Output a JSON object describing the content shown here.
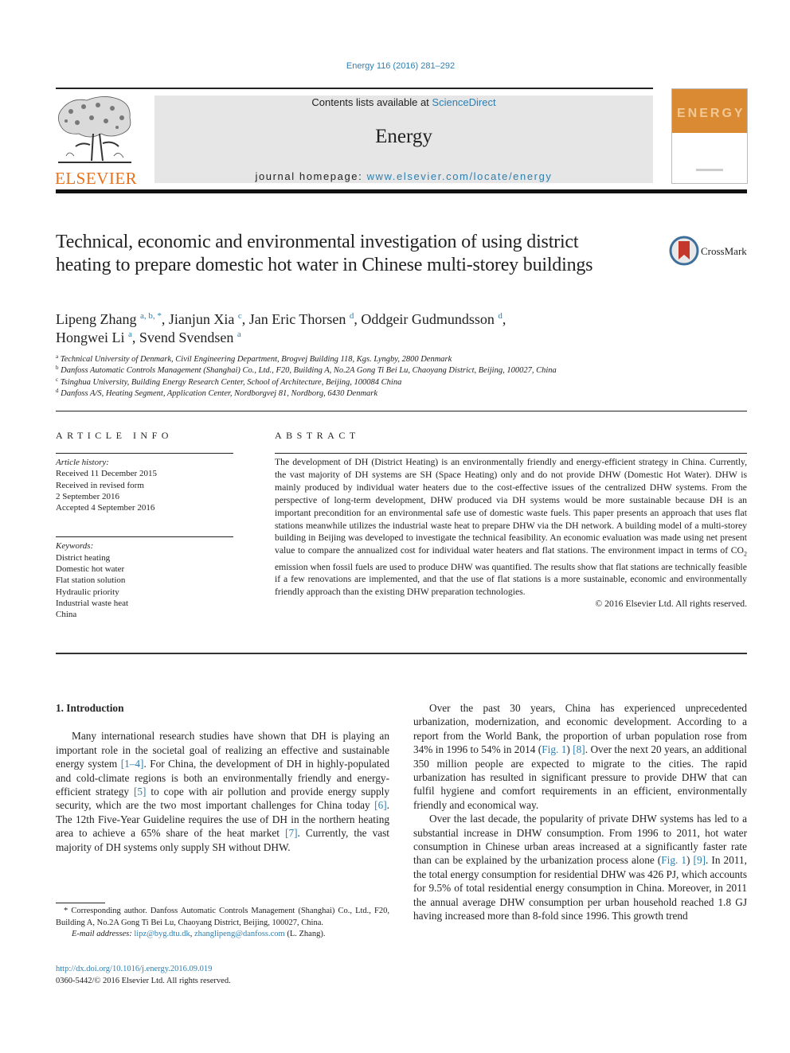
{
  "header": {
    "journal_ref": "Energy 116 (2016) 281–292",
    "contents_prefix": "Contents lists available at ",
    "contents_link": "ScienceDirect",
    "journal_name": "Energy",
    "homepage_prefix": "journal homepage: ",
    "homepage_link": "www.elsevier.com/locate/energy",
    "publisher_logo_text": "ELSEVIER",
    "cover_title": "ENERGY",
    "colors": {
      "link": "#2e7fb0",
      "publisher_orange": "#e9711c",
      "cover_orange": "#d98a33",
      "banner_gray": "#e6e6e6"
    }
  },
  "article": {
    "title": "Technical, economic and environmental investigation of using district heating to prepare domestic hot water in Chinese multi-storey buildings",
    "crossmark_label": "CrossMark",
    "authors": [
      {
        "name": "Lipeng Zhang",
        "sup": "a, b, *",
        "sep": ", "
      },
      {
        "name": "Jianjun Xia",
        "sup": "c",
        "sep": ", "
      },
      {
        "name": "Jan Eric Thorsen",
        "sup": "d",
        "sep": ", "
      },
      {
        "name": "Oddgeir Gudmundsson",
        "sup": "d",
        "sep": ","
      },
      {
        "name": "Hongwei Li",
        "sup": "a",
        "sep": ", "
      },
      {
        "name": "Svend Svendsen",
        "sup": "a",
        "sep": ""
      }
    ],
    "affiliations": [
      {
        "key": "a",
        "text": "Technical University of Denmark, Civil Engineering Department, Brogvej Building 118, Kgs. Lyngby, 2800 Denmark"
      },
      {
        "key": "b",
        "text": "Danfoss Automatic Controls Management (Shanghai) Co., Ltd., F20, Building A, No.2A Gong Ti Bei Lu, Chaoyang District, Beijing, 100027, China"
      },
      {
        "key": "c",
        "text": "Tsinghua University, Building Energy Research Center, School of Architecture, Beijing, 100084 China"
      },
      {
        "key": "d",
        "text": "Danfoss A/S, Heating Segment, Application Center, Nordborgvej 81, Nordborg, 6430 Denmark"
      }
    ]
  },
  "article_info": {
    "heading": "ARTICLE INFO",
    "history_label": "Article history:",
    "history": [
      "Received 11 December 2015",
      "Received in revised form",
      "2 September 2016",
      "Accepted 4 September 2016"
    ],
    "keywords_label": "Keywords:",
    "keywords": [
      "District heating",
      "Domestic hot water",
      "Flat station solution",
      "Hydraulic priority",
      "Industrial waste heat",
      "China"
    ]
  },
  "abstract": {
    "heading": "ABSTRACT",
    "text_before_co2": "The development of DH (District Heating) is an environmentally friendly and energy-efficient strategy in China. Currently, the vast majority of DH systems are SH (Space Heating) only and do not provide DHW (Domestic Hot Water). DHW is mainly produced by individual water heaters due to the cost-effective issues of the centralized DHW systems. From the perspective of long-term development, DHW produced via DH systems would be more sustainable because DH is an important precondition for an environmental safe use of domestic waste fuels. This paper presents an approach that uses flat stations meanwhile utilizes the industrial waste heat to prepare DHW via the DH network. A building model of a multi-storey building in Beijing was developed to investigate the technical feasibility. An economic evaluation was made using net present value to compare the annualized cost for individual water heaters and flat stations. The environment impact in terms of CO",
    "co2_sub": "2",
    "text_after_co2": " emission when fossil fuels are used to produce DHW was quantified. The results show that flat stations are technically feasible if a few renovations are implemented, and that the use of flat stations is a more sustainable, economic and environmentally friendly approach than the existing DHW preparation technologies.",
    "copyright": "© 2016 Elsevier Ltd. All rights reserved."
  },
  "body": {
    "section_heading": "1.  Introduction",
    "left_para": [
      {
        "t": "Many international research studies have shown that DH is playing an important role in the societal goal of realizing an effective and sustainable energy system "
      },
      {
        "ref": "[1–4]"
      },
      {
        "t": ". For China, the development of DH in highly-populated and cold-climate regions is both an environmentally friendly and energy-efficient strategy "
      },
      {
        "ref": "[5]"
      },
      {
        "t": " to cope with air pollution and provide energy supply security, which are the two most important challenges for China today "
      },
      {
        "ref": "[6]"
      },
      {
        "t": ". The 12th Five-Year Guideline requires the use of DH in the northern heating area to achieve a 65% share of the heat market "
      },
      {
        "ref": "[7]"
      },
      {
        "t": ". Currently, the vast majority of DH systems only supply SH without DHW."
      }
    ],
    "right_para_1": [
      {
        "t": "Over the past 30 years, China has experienced unprecedented urbanization, modernization, and economic development. According to a report from the World Bank, the proportion of urban population rose from 34% in 1996 to 54% in 2014 ("
      },
      {
        "ref": "Fig. 1"
      },
      {
        "t": ") "
      },
      {
        "ref": "[8]"
      },
      {
        "t": ". Over the next 20 years, an additional 350 million people are expected to migrate to the cities. The rapid urbanization has resulted in significant pressure to provide DHW that can fulfil hygiene and comfort requirements in an efficient, environmentally friendly and economical way."
      }
    ],
    "right_para_2": [
      {
        "t": "Over the last decade, the popularity of private DHW systems has led to a substantial increase in DHW consumption. From 1996 to 2011, hot water consumption in Chinese urban areas increased at a significantly faster rate than can be explained by the urbanization process alone ("
      },
      {
        "ref": "Fig. 1"
      },
      {
        "t": ") "
      },
      {
        "ref": "[9]"
      },
      {
        "t": ". In 2011, the total energy consumption for residential DHW was 426 PJ, which accounts for 9.5% of total residential energy consumption in China. Moreover, in 2011 the annual average DHW consumption per urban household reached 1.8 GJ having increased more than 8-fold since 1996. This growth trend"
      }
    ]
  },
  "footnotes": {
    "corresponding": "* Corresponding author. Danfoss Automatic Controls Management (Shanghai) Co., Ltd., F20, Building A, No.2A Gong Ti Bei Lu, Chaoyang District, Beijing, 100027, China.",
    "email_label": "E-mail addresses: ",
    "email_1": "lipz@byg.dtu.dk",
    "email_sep": ", ",
    "email_2": "zhanglipeng@danfoss.com",
    "email_suffix": " (L. Zhang).",
    "doi": "http://dx.doi.org/10.1016/j.energy.2016.09.019",
    "issn": "0360-5442/© 2016 Elsevier Ltd. All rights reserved."
  }
}
